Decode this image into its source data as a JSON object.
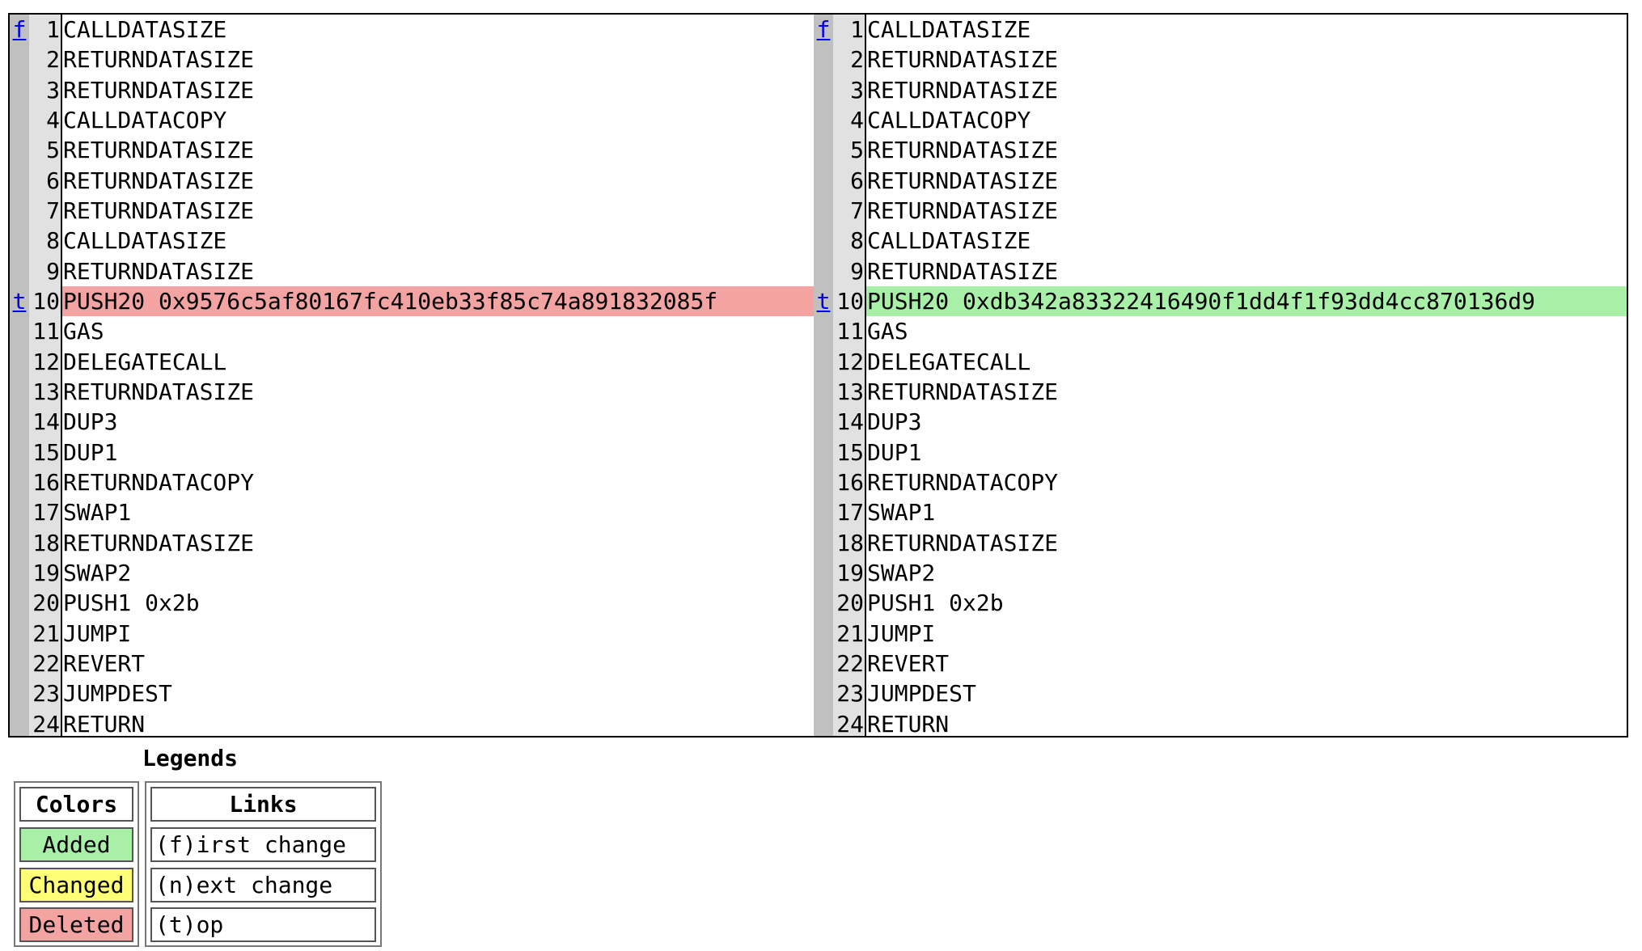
{
  "diff": {
    "left": {
      "nav": {
        "first": "f",
        "top": "t"
      },
      "lines": [
        {
          "n": "1",
          "code": "CALLDATASIZE",
          "status": ""
        },
        {
          "n": "2",
          "code": "RETURNDATASIZE",
          "status": ""
        },
        {
          "n": "3",
          "code": "RETURNDATASIZE",
          "status": ""
        },
        {
          "n": "4",
          "code": "CALLDATACOPY",
          "status": ""
        },
        {
          "n": "5",
          "code": "RETURNDATASIZE",
          "status": ""
        },
        {
          "n": "6",
          "code": "RETURNDATASIZE",
          "status": ""
        },
        {
          "n": "7",
          "code": "RETURNDATASIZE",
          "status": ""
        },
        {
          "n": "8",
          "code": "CALLDATASIZE",
          "status": ""
        },
        {
          "n": "9",
          "code": "RETURNDATASIZE",
          "status": ""
        },
        {
          "n": "10",
          "code": "PUSH20 0x9576c5af80167fc410eb33f85c74a891832085f",
          "status": "deleted"
        },
        {
          "n": "11",
          "code": "GAS",
          "status": ""
        },
        {
          "n": "12",
          "code": "DELEGATECALL",
          "status": ""
        },
        {
          "n": "13",
          "code": "RETURNDATASIZE",
          "status": ""
        },
        {
          "n": "14",
          "code": "DUP3",
          "status": ""
        },
        {
          "n": "15",
          "code": "DUP1",
          "status": ""
        },
        {
          "n": "16",
          "code": "RETURNDATACOPY",
          "status": ""
        },
        {
          "n": "17",
          "code": "SWAP1",
          "status": ""
        },
        {
          "n": "18",
          "code": "RETURNDATASIZE",
          "status": ""
        },
        {
          "n": "19",
          "code": "SWAP2",
          "status": ""
        },
        {
          "n": "20",
          "code": "PUSH1 0x2b",
          "status": ""
        },
        {
          "n": "21",
          "code": "JUMPI",
          "status": ""
        },
        {
          "n": "22",
          "code": "REVERT",
          "status": ""
        },
        {
          "n": "23",
          "code": "JUMPDEST",
          "status": ""
        },
        {
          "n": "24",
          "code": "RETURN",
          "status": ""
        }
      ]
    },
    "right": {
      "nav": {
        "first": "f",
        "top": "t"
      },
      "lines": [
        {
          "n": "1",
          "code": "CALLDATASIZE",
          "status": ""
        },
        {
          "n": "2",
          "code": "RETURNDATASIZE",
          "status": ""
        },
        {
          "n": "3",
          "code": "RETURNDATASIZE",
          "status": ""
        },
        {
          "n": "4",
          "code": "CALLDATACOPY",
          "status": ""
        },
        {
          "n": "5",
          "code": "RETURNDATASIZE",
          "status": ""
        },
        {
          "n": "6",
          "code": "RETURNDATASIZE",
          "status": ""
        },
        {
          "n": "7",
          "code": "RETURNDATASIZE",
          "status": ""
        },
        {
          "n": "8",
          "code": "CALLDATASIZE",
          "status": ""
        },
        {
          "n": "9",
          "code": "RETURNDATASIZE",
          "status": ""
        },
        {
          "n": "10",
          "code": "PUSH20 0xdb342a83322416490f1dd4f1f93dd4cc870136d9",
          "status": "added"
        },
        {
          "n": "11",
          "code": "GAS",
          "status": ""
        },
        {
          "n": "12",
          "code": "DELEGATECALL",
          "status": ""
        },
        {
          "n": "13",
          "code": "RETURNDATASIZE",
          "status": ""
        },
        {
          "n": "14",
          "code": "DUP3",
          "status": ""
        },
        {
          "n": "15",
          "code": "DUP1",
          "status": ""
        },
        {
          "n": "16",
          "code": "RETURNDATACOPY",
          "status": ""
        },
        {
          "n": "17",
          "code": "SWAP1",
          "status": ""
        },
        {
          "n": "18",
          "code": "RETURNDATASIZE",
          "status": ""
        },
        {
          "n": "19",
          "code": "SWAP2",
          "status": ""
        },
        {
          "n": "20",
          "code": "PUSH1 0x2b",
          "status": ""
        },
        {
          "n": "21",
          "code": "JUMPI",
          "status": ""
        },
        {
          "n": "22",
          "code": "REVERT",
          "status": ""
        },
        {
          "n": "23",
          "code": "JUMPDEST",
          "status": ""
        },
        {
          "n": "24",
          "code": "RETURN",
          "status": ""
        }
      ]
    }
  },
  "legends": {
    "title": "Legends",
    "colors": {
      "header": "Colors",
      "added": "Added",
      "changed": "Changed",
      "deleted": "Deleted",
      "added_color": "#a8f0a8",
      "changed_color": "#ffff77",
      "deleted_color": "#f4a3a3"
    },
    "links": {
      "header": "Links",
      "first": "(f)irst change",
      "next": "(n)ext change",
      "top": "(t)op"
    }
  }
}
